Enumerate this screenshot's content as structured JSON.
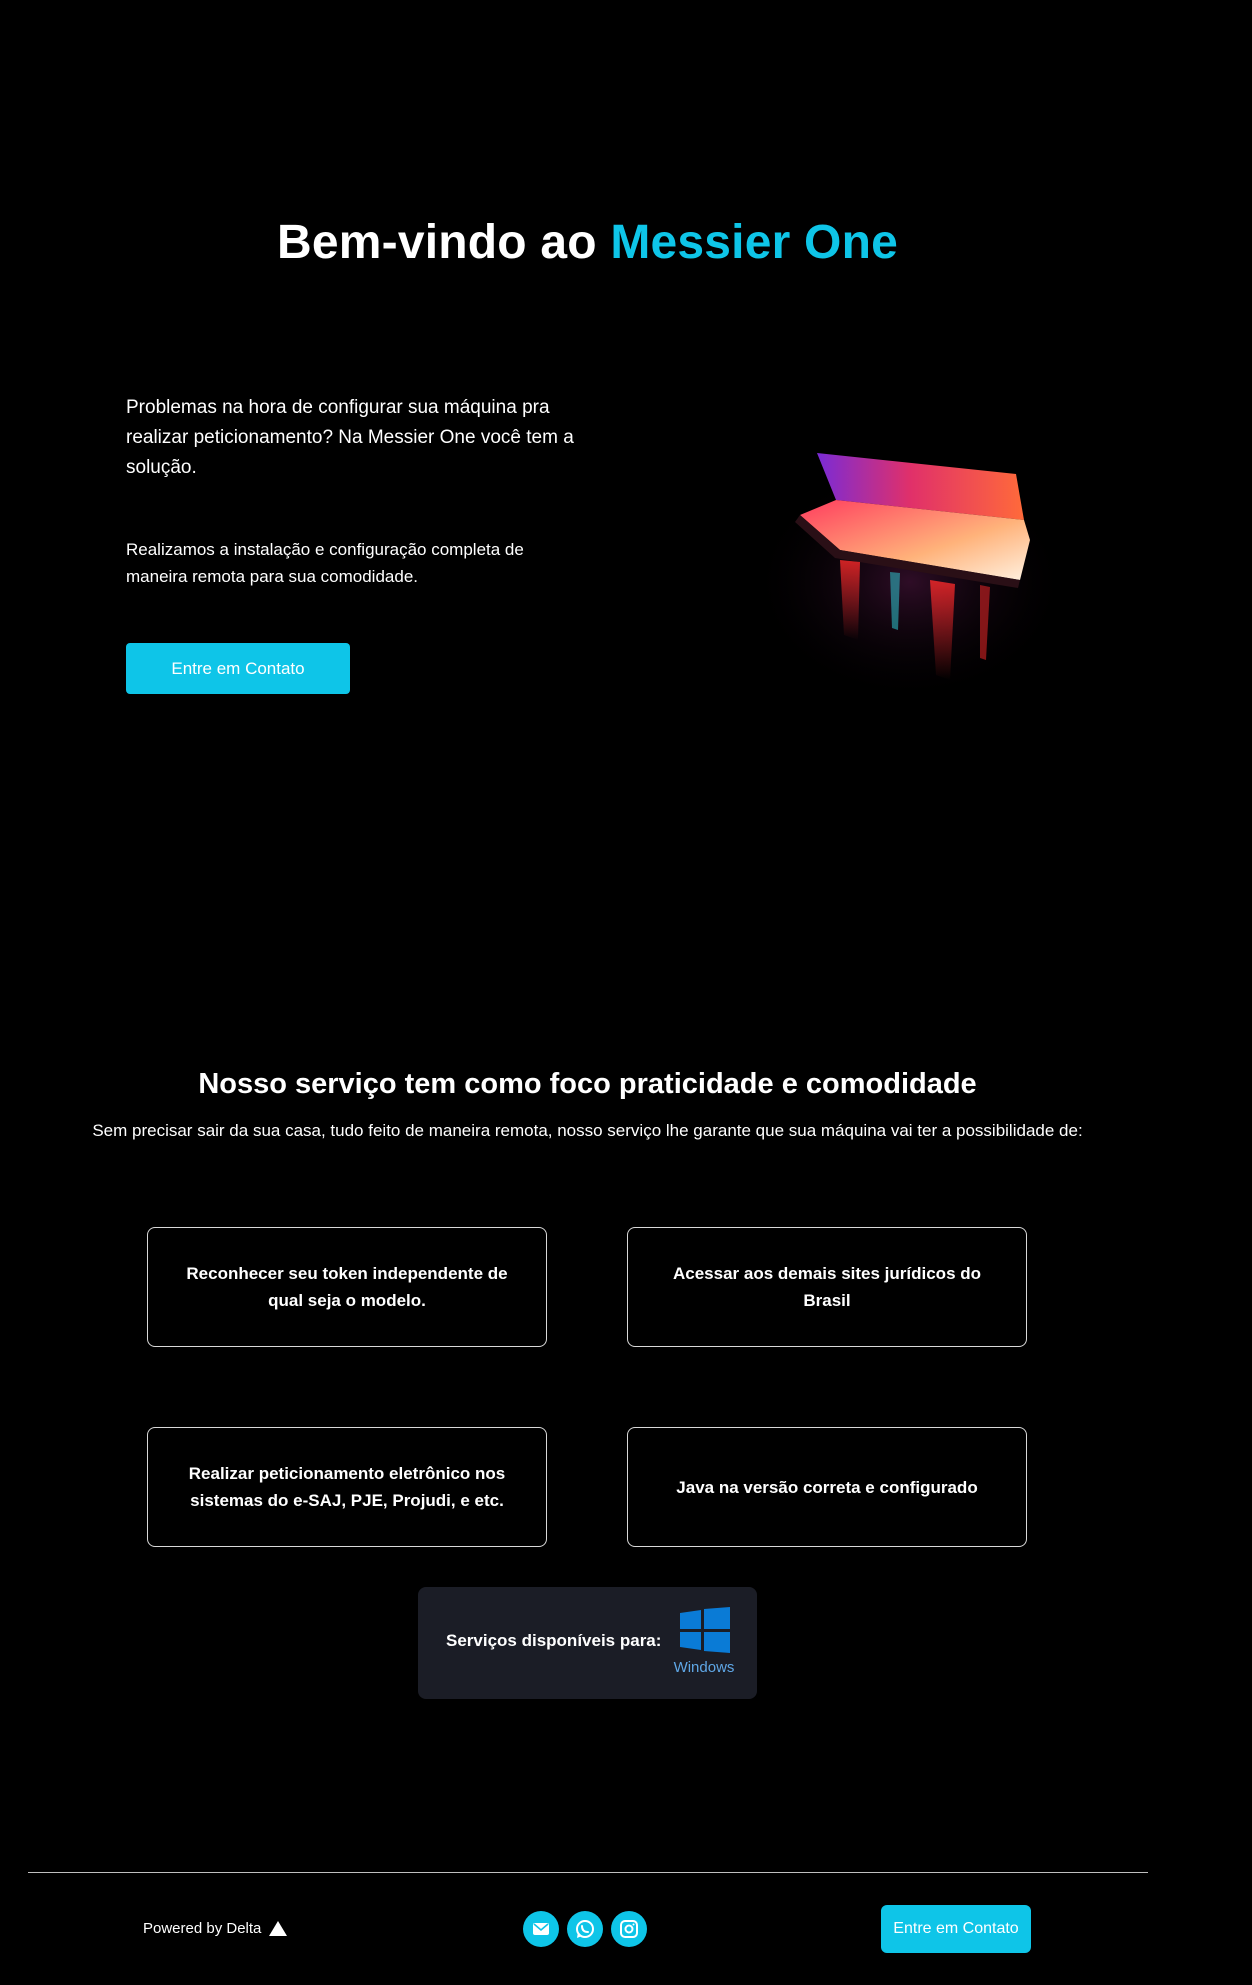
{
  "hero": {
    "title_prefix": "Bem-vindo ao ",
    "title_accent": "Messier One",
    "text": "Problemas na hora de configurar sua máquina pra realizar peticionamento? Na Messier One você tem a solução.",
    "subtext": "Realizamos a instalação e configuração completa de maneira remota para sua comodidade.",
    "cta_label": "Entre em Contato",
    "image_icon": "laptop-image"
  },
  "services": {
    "title": "Nosso serviço tem como foco praticidade e comodidade",
    "description": "Sem precisar sair da sua casa, tudo feito de maneira remota, nosso serviço lhe garante que sua máquina vai ter a possibilidade de:",
    "cards": [
      "Reconhecer seu token independente de qual seja o modelo.",
      "Acessar aos demais sites jurídicos do Brasil",
      "Realizar peticionamento eletrônico nos sistemas do e-SAJ, PJE, Projudi, e etc.",
      "Java na versão correta e configurado"
    ]
  },
  "platform": {
    "label": "Serviços disponíveis para:",
    "os_name": "Windows",
    "os_icon": "windows-icon"
  },
  "footer": {
    "powered_by": "Powered by Delta",
    "social_icons": [
      "email-icon",
      "whatsapp-icon",
      "instagram-icon"
    ],
    "cta_label": "Entre em Contato"
  },
  "colors": {
    "accent": "#0ec5e8",
    "background": "#000000",
    "card_border": "#d8d8d8",
    "platform_bg": "#1b1d26",
    "windows_blue": "#0a7bd6"
  }
}
